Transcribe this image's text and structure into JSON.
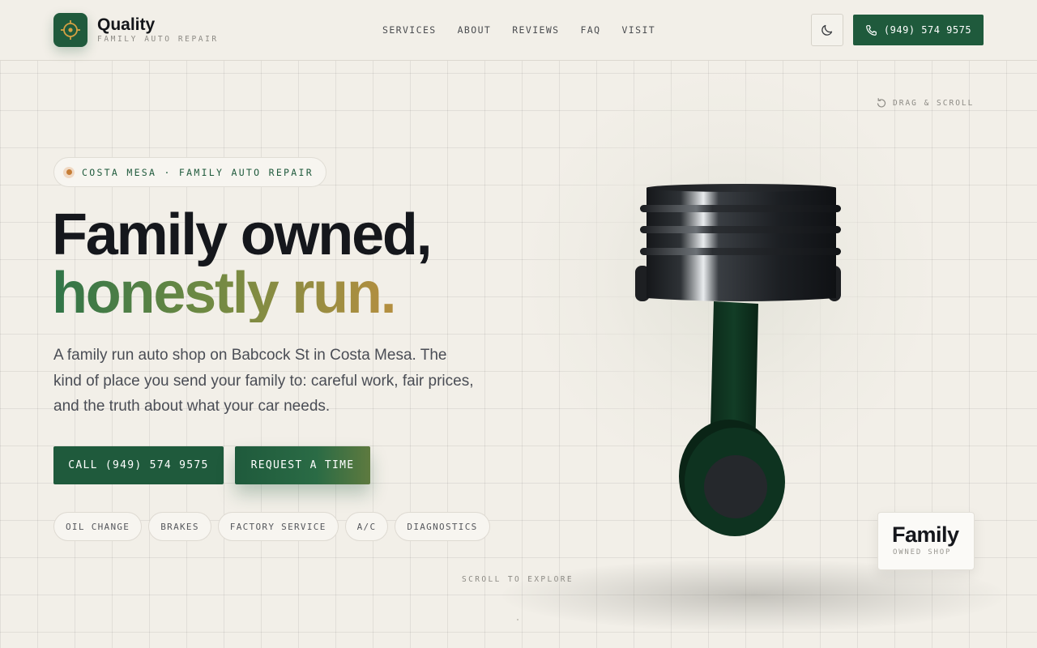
{
  "header": {
    "brand_name": "Quality",
    "brand_sub": "FAMILY AUTO REPAIR",
    "nav": [
      "SERVICES",
      "ABOUT",
      "REVIEWS",
      "FAQ",
      "VISIT"
    ],
    "phone_label": "(949) 574 9575"
  },
  "hero": {
    "drag_hint": "DRAG & SCROLL",
    "location_pill": "COSTA MESA · FAMILY AUTO REPAIR",
    "headline_line1": "Family owned,",
    "headline_line2": "honestly run.",
    "lede": "A family run auto shop on Babcock St in Costa Mesa. The kind of place you send your family to: careful work, fair prices, and the truth about what your car needs.",
    "cta_call": "CALL (949) 574 9575",
    "cta_request": "REQUEST A TIME",
    "tags": [
      "OIL CHANGE",
      "BRAKES",
      "FACTORY SERVICE",
      "A/C",
      "DIAGNOSTICS"
    ],
    "scroll_hint": "SCROLL TO EXPLORE",
    "badge_title": "Family",
    "badge_sub": "OWNED SHOP"
  },
  "icons": {
    "logo": "crosshair-icon",
    "theme_toggle": "moon-icon",
    "phone": "phone-icon",
    "drag": "rotate-icon"
  },
  "colors": {
    "brand_green": "#1f5a3c",
    "accent_orange": "#c57d36",
    "background": "#f2efe8"
  }
}
